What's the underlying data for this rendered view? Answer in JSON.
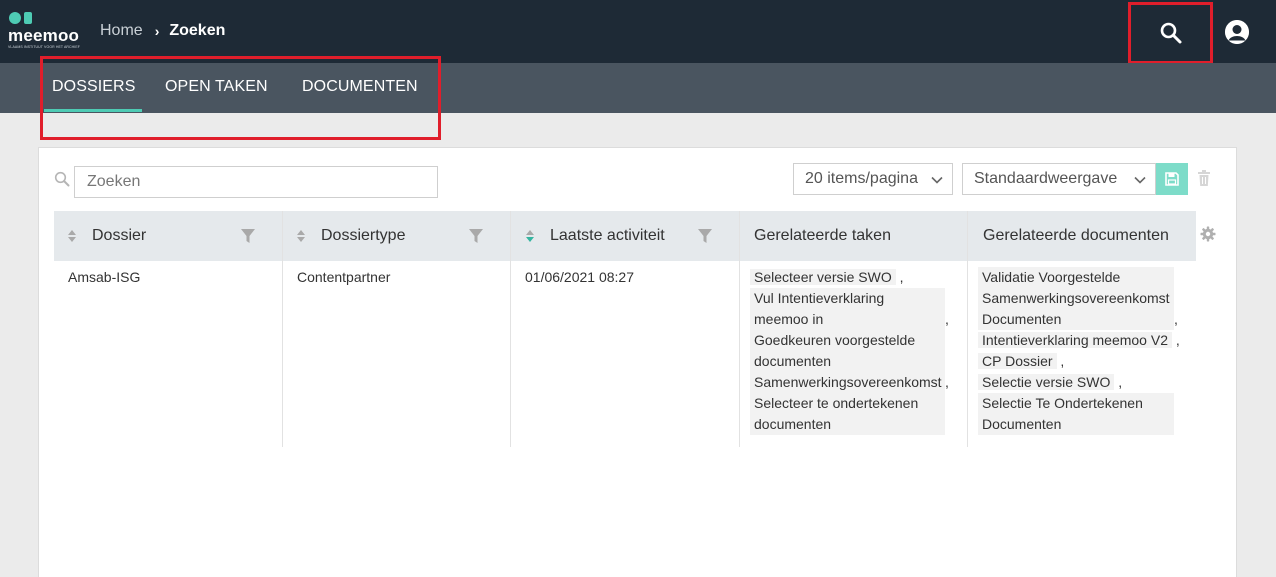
{
  "header": {
    "logo": {
      "wordmark": "meemoo",
      "tagline": "VLAAMS INSTITUUT VOOR HET ARCHIEF"
    },
    "breadcrumb": {
      "home": "Home",
      "separator": "›",
      "current": "Zoeken"
    },
    "icons": {
      "search": "search-icon",
      "user": "user-avatar-icon"
    },
    "colors": {
      "bar": "#1e2a36",
      "accent": "#4ecbb4",
      "highlight": "#e01e2b"
    }
  },
  "tabs": [
    {
      "label": "DOSSIERS",
      "active": true
    },
    {
      "label": "OPEN TAKEN",
      "active": false
    },
    {
      "label": "DOCUMENTEN",
      "active": false
    }
  ],
  "toolbar": {
    "search_placeholder": "Zoeken",
    "page_size": "20 items/pagina",
    "view": "Standaardweergave",
    "icons": {
      "search": "search-icon",
      "save": "floppy-disk-icon",
      "delete": "trash-icon",
      "settings": "gear-icon"
    }
  },
  "table": {
    "columns": [
      {
        "label": "Dossier",
        "sortable": true,
        "filterable": true
      },
      {
        "label": "Dossiertype",
        "sortable": true,
        "filterable": true
      },
      {
        "label": "Laatste activiteit",
        "sortable": true,
        "filterable": true,
        "sorted": "desc"
      },
      {
        "label": "Gerelateerde taken",
        "sortable": false,
        "filterable": false
      },
      {
        "label": "Gerelateerde documenten",
        "sortable": false,
        "filterable": false
      }
    ],
    "rows": [
      {
        "dossier": "Amsab-ISG",
        "type": "Contentpartner",
        "activity": "01/06/2021 08:27",
        "tasks": [
          "Selecteer versie SWO",
          "Vul Intentieverklaring meemoo in",
          "Goedkeuren voorgestelde documenten Samenwerkingsovereenkomst",
          "Selecteer te ondertekenen documenten"
        ],
        "documents": [
          "Validatie Voorgestelde Samenwerkingsovereenkomst Documenten",
          "Intentieverklaring meemoo V2",
          "CP Dossier",
          "Selectie versie SWO",
          "Selectie Te Ondertekenen Documenten"
        ]
      }
    ]
  }
}
